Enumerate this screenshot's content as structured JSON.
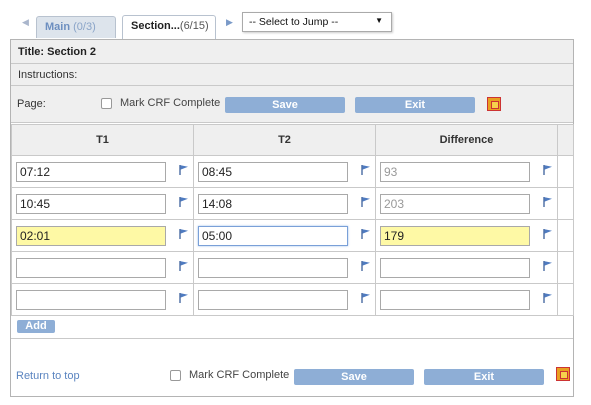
{
  "tabs": [
    {
      "label": "Main",
      "count": "(0/3)",
      "active": false
    },
    {
      "label": "Section...",
      "count": "(6/15)",
      "active": true
    }
  ],
  "jump_select": {
    "selected": "-- Select to Jump --"
  },
  "form": {
    "title": "Title: Section 2",
    "instructions": "Instructions:",
    "page_label": "Page:",
    "mark_complete_label": "Mark CRF Complete",
    "save_label": "Save",
    "exit_label": "Exit"
  },
  "grid": {
    "headers": [
      "T1",
      "T2",
      "Difference"
    ],
    "rows": [
      {
        "t1": "07:12",
        "t2": "08:45",
        "diff": "93"
      },
      {
        "t1": "10:45",
        "t2": "14:08",
        "diff": "203"
      },
      {
        "t1": "02:01",
        "t2": "05:00",
        "diff": "179"
      },
      {
        "t1": "",
        "t2": "",
        "diff": ""
      },
      {
        "t1": "",
        "t2": "",
        "diff": ""
      }
    ],
    "add_label": "Add"
  },
  "footer": {
    "return_link": "Return to top",
    "mark_complete_label": "Mark CRF Complete",
    "save_label": "Save",
    "exit_label": "Exit"
  },
  "colors": {
    "button": "#8eaed6",
    "highlight": "#fef9a5",
    "link": "#5a84c0",
    "bar": "#efefef"
  },
  "icons": [
    "left-arrow-icon",
    "right-arrow-icon",
    "chevron-down-icon",
    "pdf-icon",
    "flag-icon"
  ]
}
